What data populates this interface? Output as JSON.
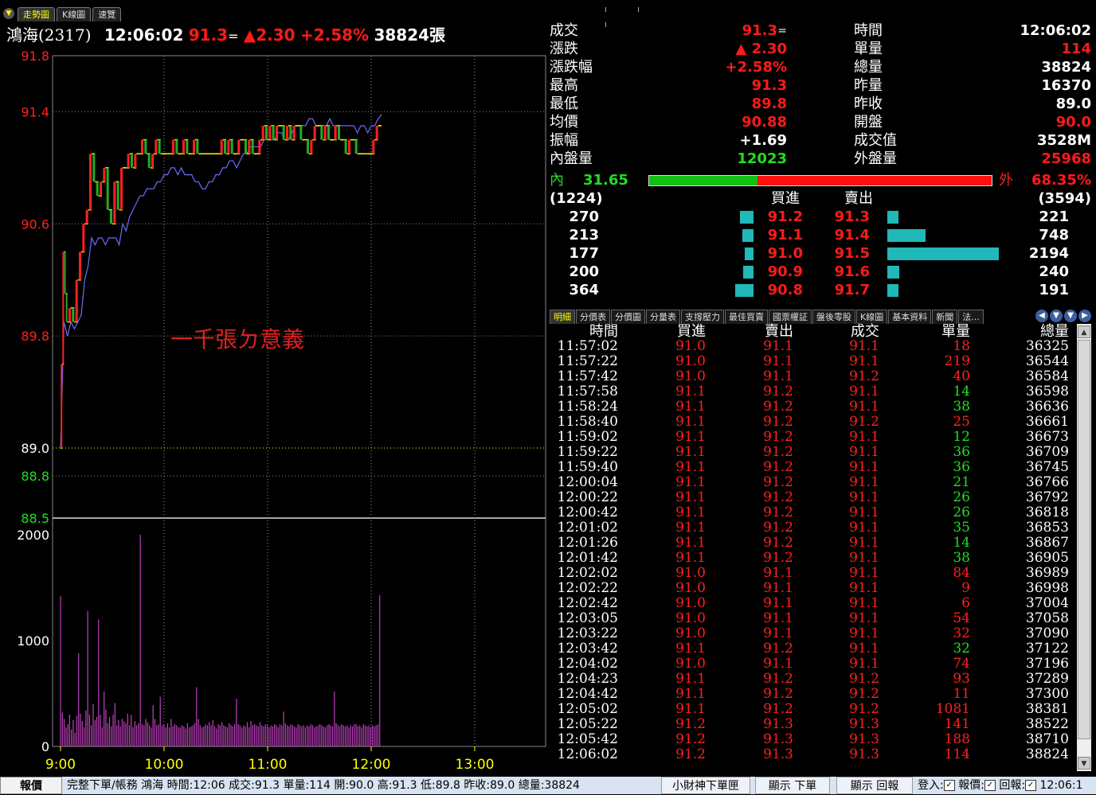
{
  "tabs": [
    {
      "label": "走勢圖",
      "active": true
    },
    {
      "label": "K線圖",
      "active": false
    },
    {
      "label": "速覽",
      "active": false
    }
  ],
  "header": {
    "name": "鴻海(2317)",
    "time": "12:06:02",
    "price": "91.3",
    "eq": "=",
    "change": "▲2.30",
    "pct": "+2.58%",
    "volume": "38824張"
  },
  "chart_data": {
    "type": "line",
    "x_labels": [
      "9:00",
      "10:00",
      "11:00",
      "12:00",
      "13:00"
    ],
    "price_ticks": [
      {
        "label": "91.8",
        "v": 91.8,
        "color": "#ff2020"
      },
      {
        "label": "91.4",
        "v": 91.4,
        "color": "#ff2020"
      },
      {
        "label": "90.6",
        "v": 90.6,
        "color": "#ff2020"
      },
      {
        "label": "89.8",
        "v": 89.8,
        "color": "#ff2020"
      },
      {
        "label": "89.0",
        "v": 89.0,
        "color": "#ffffff"
      },
      {
        "label": "88.8",
        "v": 88.8,
        "color": "#22dd22"
      },
      {
        "label": "88.5",
        "v": 88.5,
        "color": "#22dd22"
      }
    ],
    "volume_ticks": [
      "2000",
      "1000",
      "0"
    ],
    "ylim": [
      88.5,
      91.8
    ],
    "vol_max": 2000,
    "annotation": "一千張ㄉ意義",
    "price_series": [
      [
        0,
        89.0
      ],
      [
        1,
        89.6
      ],
      [
        2,
        90.4
      ],
      [
        3,
        90.1
      ],
      [
        4,
        89.9
      ],
      [
        6,
        90.0
      ],
      [
        8,
        89.9
      ],
      [
        10,
        90.2
      ],
      [
        12,
        90.4
      ],
      [
        14,
        90.6
      ],
      [
        16,
        90.7
      ],
      [
        18,
        91.1
      ],
      [
        20,
        90.9
      ],
      [
        22,
        90.8
      ],
      [
        24,
        90.9
      ],
      [
        26,
        91.0
      ],
      [
        28,
        90.7
      ],
      [
        30,
        90.6
      ],
      [
        32,
        90.9
      ],
      [
        34,
        90.7
      ],
      [
        36,
        91.0
      ],
      [
        38,
        91.0
      ],
      [
        40,
        91.1
      ],
      [
        42,
        91.0
      ],
      [
        44,
        91.1
      ],
      [
        46,
        91.1
      ],
      [
        48,
        91.2
      ],
      [
        50,
        91.1
      ],
      [
        52,
        91.0
      ],
      [
        54,
        91.1
      ],
      [
        56,
        91.2
      ],
      [
        58,
        91.1
      ],
      [
        60,
        91.1
      ],
      [
        62,
        91.1
      ],
      [
        64,
        91.1
      ],
      [
        66,
        91.2
      ],
      [
        68,
        91.1
      ],
      [
        70,
        91.1
      ],
      [
        72,
        91.2
      ],
      [
        74,
        91.1
      ],
      [
        76,
        91.1
      ],
      [
        78,
        91.2
      ],
      [
        80,
        91.1
      ],
      [
        82,
        91.1
      ],
      [
        84,
        91.1
      ],
      [
        86,
        91.1
      ],
      [
        88,
        91.1
      ],
      [
        90,
        91.1
      ],
      [
        92,
        91.1
      ],
      [
        94,
        91.2
      ],
      [
        96,
        91.1
      ],
      [
        98,
        91.2
      ],
      [
        100,
        91.1
      ],
      [
        102,
        91.1
      ],
      [
        104,
        91.2
      ],
      [
        106,
        91.2
      ],
      [
        108,
        91.1
      ],
      [
        110,
        91.2
      ],
      [
        112,
        91.1
      ],
      [
        114,
        91.1
      ],
      [
        116,
        91.2
      ],
      [
        118,
        91.3
      ],
      [
        120,
        91.2
      ],
      [
        122,
        91.3
      ],
      [
        124,
        91.2
      ],
      [
        126,
        91.3
      ],
      [
        128,
        91.3
      ],
      [
        130,
        91.2
      ],
      [
        132,
        91.3
      ],
      [
        134,
        91.2
      ],
      [
        136,
        91.3
      ],
      [
        138,
        91.3
      ],
      [
        140,
        91.2
      ],
      [
        142,
        91.2
      ],
      [
        144,
        91.1
      ],
      [
        146,
        91.2
      ],
      [
        148,
        91.3
      ],
      [
        150,
        91.3
      ],
      [
        152,
        91.2
      ],
      [
        154,
        91.3
      ],
      [
        156,
        91.2
      ],
      [
        158,
        91.2
      ],
      [
        160,
        91.3
      ],
      [
        162,
        91.2
      ],
      [
        164,
        91.2
      ],
      [
        166,
        91.1
      ],
      [
        168,
        91.2
      ],
      [
        170,
        91.2
      ],
      [
        172,
        91.1
      ],
      [
        174,
        91.1
      ],
      [
        176,
        91.1
      ],
      [
        178,
        91.1
      ],
      [
        180,
        91.1
      ],
      [
        182,
        91.2
      ],
      [
        184,
        91.3
      ],
      [
        186,
        91.3
      ]
    ],
    "avg_series": [
      [
        0,
        89.0
      ],
      [
        2,
        89.9
      ],
      [
        4,
        89.8
      ],
      [
        6,
        89.9
      ],
      [
        8,
        89.85
      ],
      [
        10,
        89.9
      ],
      [
        12,
        89.95
      ],
      [
        14,
        90.2
      ],
      [
        16,
        90.3
      ],
      [
        18,
        90.5
      ],
      [
        20,
        90.45
      ],
      [
        22,
        90.5
      ],
      [
        24,
        90.5
      ],
      [
        26,
        90.45
      ],
      [
        28,
        90.5
      ],
      [
        30,
        90.5
      ],
      [
        32,
        90.5
      ],
      [
        34,
        90.45
      ],
      [
        36,
        90.6
      ],
      [
        38,
        90.55
      ],
      [
        40,
        90.65
      ],
      [
        42,
        90.7
      ],
      [
        44,
        90.75
      ],
      [
        46,
        90.8
      ],
      [
        48,
        90.8
      ],
      [
        50,
        90.85
      ],
      [
        52,
        90.85
      ],
      [
        54,
        90.85
      ],
      [
        56,
        90.9
      ],
      [
        58,
        90.9
      ],
      [
        60,
        90.95
      ],
      [
        62,
        90.95
      ],
      [
        64,
        91.0
      ],
      [
        66,
        91.0
      ],
      [
        68,
        90.95
      ],
      [
        70,
        91.0
      ],
      [
        72,
        90.95
      ],
      [
        74,
        90.95
      ],
      [
        76,
        90.95
      ],
      [
        78,
        90.9
      ],
      [
        80,
        90.9
      ],
      [
        82,
        90.85
      ],
      [
        84,
        90.85
      ],
      [
        86,
        90.9
      ],
      [
        88,
        90.9
      ],
      [
        90,
        90.95
      ],
      [
        92,
        90.95
      ],
      [
        94,
        91.0
      ],
      [
        96,
        91.0
      ],
      [
        98,
        91.05
      ],
      [
        100,
        91.05
      ],
      [
        102,
        91.0
      ],
      [
        104,
        91.05
      ],
      [
        106,
        91.1
      ],
      [
        108,
        91.1
      ],
      [
        110,
        91.15
      ],
      [
        112,
        91.15
      ],
      [
        114,
        91.15
      ],
      [
        116,
        91.15
      ],
      [
        118,
        91.2
      ],
      [
        120,
        91.2
      ],
      [
        122,
        91.2
      ],
      [
        124,
        91.2
      ],
      [
        126,
        91.25
      ],
      [
        128,
        91.25
      ],
      [
        130,
        91.2
      ],
      [
        132,
        91.2
      ],
      [
        134,
        91.25
      ],
      [
        136,
        91.3
      ],
      [
        138,
        91.3
      ],
      [
        140,
        91.3
      ],
      [
        142,
        91.3
      ],
      [
        144,
        91.35
      ],
      [
        146,
        91.35
      ],
      [
        148,
        91.3
      ],
      [
        150,
        91.3
      ],
      [
        152,
        91.3
      ],
      [
        154,
        91.3
      ],
      [
        156,
        91.35
      ],
      [
        158,
        91.3
      ],
      [
        160,
        91.3
      ],
      [
        162,
        91.3
      ],
      [
        164,
        91.3
      ],
      [
        166,
        91.3
      ],
      [
        168,
        91.3
      ],
      [
        170,
        91.3
      ],
      [
        172,
        91.25
      ],
      [
        174,
        91.3
      ],
      [
        176,
        91.3
      ],
      [
        178,
        91.25
      ],
      [
        180,
        91.3
      ],
      [
        182,
        91.3
      ],
      [
        184,
        91.35
      ],
      [
        186,
        91.38
      ]
    ],
    "volume": [
      1420,
      320,
      260,
      180,
      210,
      300,
      160,
      250,
      130,
      290,
      880,
      310,
      240,
      180,
      340,
      1280,
      300,
      200,
      400,
      250,
      280,
      1200,
      300,
      180,
      520,
      350,
      220,
      280,
      190,
      300,
      410,
      200,
      250,
      190,
      260,
      240,
      220,
      310,
      200,
      300,
      180,
      240,
      200,
      220,
      2000,
      210,
      200,
      260,
      230,
      200,
      180,
      390,
      260,
      200,
      210,
      470,
      200,
      210,
      180,
      220,
      180,
      260,
      190,
      210,
      200,
      180,
      180,
      200,
      190,
      170,
      220,
      180,
      190,
      200,
      220,
      560,
      260,
      200,
      180,
      190,
      210,
      200,
      230,
      200,
      250,
      190,
      170,
      210,
      200,
      230,
      200,
      190,
      180,
      220,
      200,
      190,
      210,
      450,
      210,
      200,
      180,
      200,
      190,
      230,
      180,
      240,
      200,
      210,
      200,
      190,
      230,
      200,
      190,
      210,
      200,
      180,
      200,
      190,
      210,
      200,
      180,
      210,
      200,
      330,
      220,
      200,
      190,
      210,
      200,
      190,
      180,
      210,
      200,
      190,
      200,
      180,
      200,
      190,
      210,
      200,
      180,
      190,
      200,
      210,
      200,
      190,
      180,
      200,
      210,
      200,
      190,
      520,
      220,
      200,
      190,
      210,
      200,
      190,
      200,
      180,
      200,
      190,
      210,
      210,
      190,
      200,
      180,
      210,
      200,
      190,
      200,
      180,
      200,
      190,
      200,
      210,
      1430
    ]
  },
  "info": {
    "left": [
      {
        "label": "成交",
        "value": "91.3",
        "color": "r",
        "suffix": "="
      },
      {
        "label": "漲跌",
        "value": "▲ 2.30",
        "color": "r"
      },
      {
        "label": "漲跌幅",
        "value": "+2.58%",
        "color": "r"
      },
      {
        "label": "最高",
        "value": "91.3",
        "color": "r"
      },
      {
        "label": "最低",
        "value": "89.8",
        "color": "r"
      },
      {
        "label": "均價",
        "value": "90.88",
        "color": "r"
      },
      {
        "label": "振幅",
        "value": "+1.69",
        "color": "w"
      },
      {
        "label": "內盤量",
        "value": "12023",
        "color": "g"
      }
    ],
    "right": [
      {
        "label": "時間",
        "value": "12:06:02",
        "color": "w"
      },
      {
        "label": "單量",
        "value": "114",
        "color": "r"
      },
      {
        "label": "總量",
        "value": "38824",
        "color": "w"
      },
      {
        "label": "昨量",
        "value": "16370",
        "color": "w"
      },
      {
        "label": "昨收",
        "value": "89.0",
        "color": "w"
      },
      {
        "label": "開盤",
        "value": "90.0",
        "color": "r"
      },
      {
        "label": "成交值",
        "value": "3528M",
        "color": "w"
      },
      {
        "label": "外盤量",
        "value": "25968",
        "color": "r"
      }
    ],
    "in_label": "內",
    "in_pct": "31.65",
    "out_label": "外",
    "out_pct": "68.35%",
    "in_ratio": 0.3165,
    "bid_total": "(1224)",
    "ask_total": "(3594)",
    "bid_head": "買進",
    "ask_head": "賣出",
    "book": [
      {
        "bid_vol": "270",
        "bid": "91.2",
        "ask": "91.3",
        "ask_vol": "221",
        "bv": 270,
        "av": 221
      },
      {
        "bid_vol": "213",
        "bid": "91.1",
        "ask": "91.4",
        "ask_vol": "748",
        "bv": 213,
        "av": 748
      },
      {
        "bid_vol": "177",
        "bid": "91.0",
        "ask": "91.5",
        "ask_vol": "2194",
        "bv": 177,
        "av": 2194
      },
      {
        "bid_vol": "200",
        "bid": "90.9",
        "ask": "91.6",
        "ask_vol": "240",
        "bv": 200,
        "av": 240
      },
      {
        "bid_vol": "364",
        "bid": "90.8",
        "ask": "91.7",
        "ask_vol": "191",
        "bv": 364,
        "av": 191
      }
    ]
  },
  "lower_tabs": [
    "明細",
    "分價表",
    "分價圖",
    "分量表",
    "支撐壓力",
    "最佳買賣",
    "國票權証",
    "盤後零股",
    "K線圖",
    "基本資料",
    "新聞",
    "法..."
  ],
  "ticks": {
    "headers": [
      "時間",
      "買進",
      "賣出",
      "成交",
      "單量",
      "總量"
    ],
    "rows": [
      [
        "11:57:02",
        "91.0",
        "91.1",
        "91.1",
        "18",
        "36325",
        "r"
      ],
      [
        "11:57:22",
        "91.0",
        "91.1",
        "91.1",
        "219",
        "36544",
        "r"
      ],
      [
        "11:57:42",
        "91.0",
        "91.1",
        "91.2",
        "40",
        "36584",
        "r"
      ],
      [
        "11:57:58",
        "91.1",
        "91.2",
        "91.1",
        "14",
        "36598",
        "g"
      ],
      [
        "11:58:24",
        "91.1",
        "91.2",
        "91.1",
        "38",
        "36636",
        "g"
      ],
      [
        "11:58:40",
        "91.1",
        "91.2",
        "91.2",
        "25",
        "36661",
        "r"
      ],
      [
        "11:59:02",
        "91.1",
        "91.2",
        "91.1",
        "12",
        "36673",
        "g"
      ],
      [
        "11:59:22",
        "91.1",
        "91.2",
        "91.1",
        "36",
        "36709",
        "g"
      ],
      [
        "11:59:40",
        "91.1",
        "91.2",
        "91.1",
        "36",
        "36745",
        "g"
      ],
      [
        "12:00:04",
        "91.1",
        "91.2",
        "91.1",
        "21",
        "36766",
        "g"
      ],
      [
        "12:00:22",
        "91.1",
        "91.2",
        "91.1",
        "26",
        "36792",
        "g"
      ],
      [
        "12:00:42",
        "91.1",
        "91.2",
        "91.1",
        "26",
        "36818",
        "g"
      ],
      [
        "12:01:02",
        "91.1",
        "91.2",
        "91.1",
        "35",
        "36853",
        "g"
      ],
      [
        "12:01:26",
        "91.1",
        "91.2",
        "91.1",
        "14",
        "36867",
        "g"
      ],
      [
        "12:01:42",
        "91.1",
        "91.2",
        "91.1",
        "38",
        "36905",
        "g"
      ],
      [
        "12:02:02",
        "91.0",
        "91.1",
        "91.1",
        "84",
        "36989",
        "r"
      ],
      [
        "12:02:22",
        "91.0",
        "91.1",
        "91.1",
        "9",
        "36998",
        "r"
      ],
      [
        "12:02:42",
        "91.0",
        "91.1",
        "91.1",
        "6",
        "37004",
        "r"
      ],
      [
        "12:03:05",
        "91.0",
        "91.1",
        "91.1",
        "54",
        "37058",
        "r"
      ],
      [
        "12:03:22",
        "91.0",
        "91.1",
        "91.1",
        "32",
        "37090",
        "r"
      ],
      [
        "12:03:42",
        "91.1",
        "91.2",
        "91.1",
        "32",
        "37122",
        "g"
      ],
      [
        "12:04:02",
        "91.0",
        "91.1",
        "91.1",
        "74",
        "37196",
        "r"
      ],
      [
        "12:04:23",
        "91.1",
        "91.2",
        "91.2",
        "93",
        "37289",
        "r"
      ],
      [
        "12:04:42",
        "91.1",
        "91.2",
        "91.2",
        "11",
        "37300",
        "r"
      ],
      [
        "12:05:02",
        "91.1",
        "91.2",
        "91.2",
        "1081",
        "38381",
        "r"
      ],
      [
        "12:05:22",
        "91.2",
        "91.3",
        "91.3",
        "141",
        "38522",
        "r"
      ],
      [
        "12:05:42",
        "91.2",
        "91.3",
        "91.3",
        "188",
        "38710",
        "r"
      ],
      [
        "12:06:02",
        "91.2",
        "91.3",
        "91.3",
        "114",
        "38824",
        "r"
      ]
    ]
  },
  "status": {
    "report": "報價",
    "ticker": "完整下單/帳務 鴻海 時間:12:06 成交:91.3 單量:114 開:90.0 高:91.3 低:89.8 昨收:89.0 總量:38824",
    "btn1": "小財神下單匣",
    "btn2": "顯示 下單",
    "btn3": "顯示 回報",
    "login": "登入:",
    "quote": "報價:",
    "reply": "回報:",
    "clock": "12:06:1"
  }
}
